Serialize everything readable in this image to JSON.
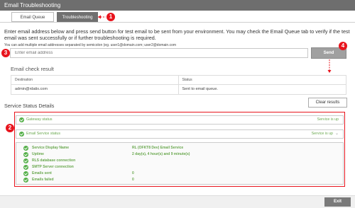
{
  "window": {
    "title": "Email Troubleshooting"
  },
  "tabs": [
    {
      "label": "Email Queue",
      "active": false
    },
    {
      "label": "Troubleshooting",
      "active": true
    }
  ],
  "intro": {
    "text": "Enter email address below and press send button for test email to be sent from your environment. You may check the Email Queue tab to verify if the test email was sent successfully or if further troubleshooting is required.",
    "hint": "You can add multiple email addresses separated by semicolon (eg. user1@domain.com; user2@domain.com"
  },
  "email_input": {
    "placeholder": "Enter email address",
    "value": ""
  },
  "send_button": {
    "label": "Send"
  },
  "email_check": {
    "title": "Email check result",
    "columns": [
      "Destination",
      "Status"
    ],
    "rows": [
      {
        "destination": "admin@rdatix.com",
        "status": "Sent to email queue."
      }
    ]
  },
  "clear_button": {
    "label": "Clear results"
  },
  "service_status": {
    "title": "Service Status Details",
    "services": [
      {
        "name": "Gateway status",
        "status": "Service is up"
      },
      {
        "name": "Email Service status",
        "status": "Service is up"
      }
    ],
    "details": [
      {
        "label": "Service Display Name",
        "value": "RL (OFKT8 Dev) Email Service"
      },
      {
        "label": "Uptime",
        "value": "2 day(s), 4 hour(s) and 9 minute(s)"
      },
      {
        "label": "RLS database connection",
        "value": ""
      },
      {
        "label": "SMTP Server connection",
        "value": ""
      },
      {
        "label": "Emails sent",
        "value": "0"
      },
      {
        "label": "Emails failed",
        "value": "0"
      }
    ]
  },
  "callouts": [
    "1",
    "2",
    "3",
    "4"
  ],
  "footer": {
    "exit_label": "Exit"
  },
  "colors": {
    "callout": "#e8141d",
    "ok_green": "#55b04a",
    "titlebar": "#6e6e6e"
  }
}
